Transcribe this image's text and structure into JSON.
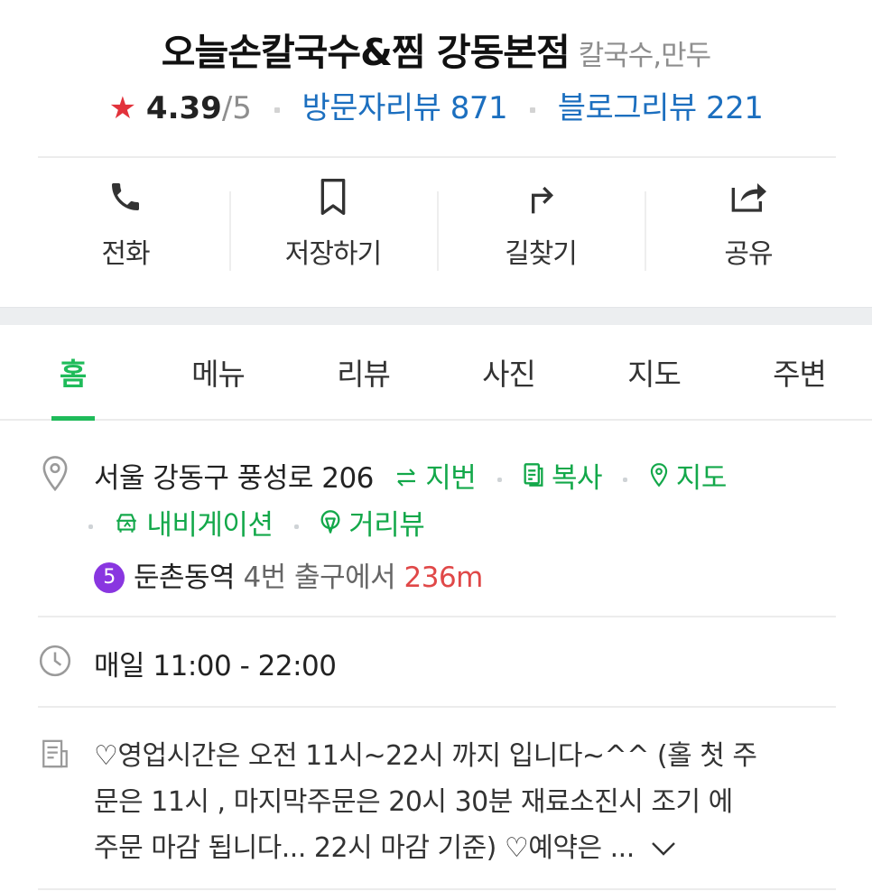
{
  "place": {
    "name": "오늘손칼국수&찜 강동본점",
    "category": "칼국수,만두",
    "rating_star": "★",
    "rating_value": "4.39",
    "rating_max": "/5",
    "visitor_reviews": "방문자리뷰 871",
    "blog_reviews": "블로그리뷰 221"
  },
  "actions": [
    {
      "label": "전화",
      "icon": "phone-icon"
    },
    {
      "label": "저장하기",
      "icon": "bookmark-icon"
    },
    {
      "label": "길찾기",
      "icon": "directions-icon"
    },
    {
      "label": "공유",
      "icon": "share-icon"
    }
  ],
  "tabs": [
    {
      "label": "홈",
      "active": true
    },
    {
      "label": "메뉴"
    },
    {
      "label": "리뷰"
    },
    {
      "label": "사진"
    },
    {
      "label": "지도"
    },
    {
      "label": "주변"
    }
  ],
  "address": {
    "text": "서울 강동구 풍성로 206",
    "jibeon": "지번",
    "copy": "복사",
    "map": "지도",
    "navigation": "내비게이션",
    "street_view": "거리뷰"
  },
  "subway": {
    "line_number": "5",
    "line_color": "#8936e0",
    "station": "둔촌동역",
    "exit": "4번 출구에서",
    "distance": "236m"
  },
  "hours": {
    "text": "매일 11:00 - 22:00"
  },
  "description": {
    "line1": "♡영업시간은 오전 11시~22시 까지 입니다~^^ (홀 첫 주",
    "line2": "문은 11시 , 마지막주문은 20시 30분 재료소진시 조기 에",
    "line3": "주문 마감 됩니다... 22시 마감 기준) ♡예약은 ... ",
    "expand_icon": "chevron-down-icon"
  },
  "colors": {
    "accent_green": "#1fbb5a",
    "link_blue": "#1c6fbf",
    "star_red": "#e2323b",
    "distance_red": "#e04848"
  }
}
